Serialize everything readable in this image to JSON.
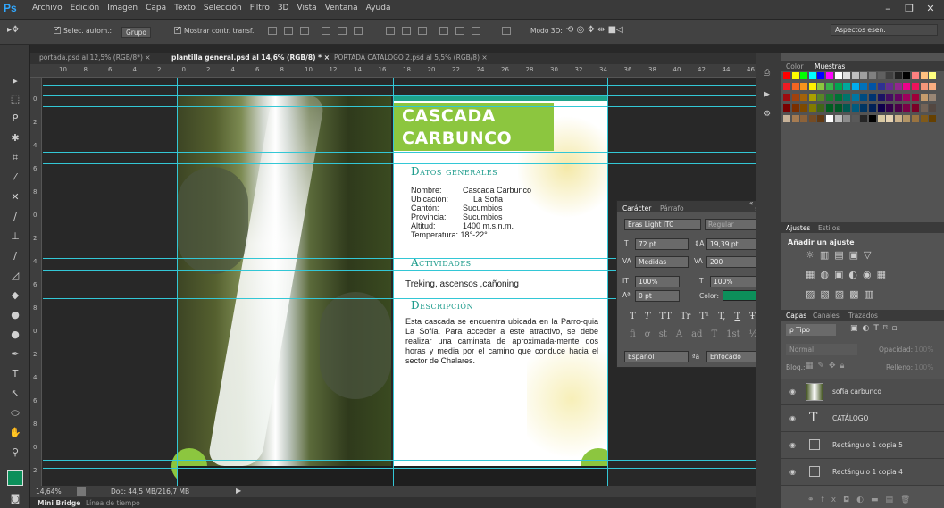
{
  "app": {
    "logo": "Ps"
  },
  "menu": [
    "Archivo",
    "Edición",
    "Imagen",
    "Capa",
    "Texto",
    "Selección",
    "Filtro",
    "3D",
    "Vista",
    "Ventana",
    "Ayuda"
  ],
  "window_controls": {
    "minimize": "–",
    "restore": "❐",
    "close": "✕"
  },
  "options": {
    "auto_select_label": "Selec. autom.:",
    "auto_select_value": "Grupo",
    "show_transform_label": "Mostrar contr. transf.",
    "mode3d_label": "Modo 3D:",
    "workspace": "Aspectos esen."
  },
  "tabs": [
    {
      "label": "portada.psd al 12,5% (RGB/8*)",
      "close": "×"
    },
    {
      "label": "plantilla general.psd al 14,6% (RGB/8) *",
      "close": "×"
    },
    {
      "label": "PORTADA CATALOGO 2.psd al 5,5% (RGB/8)",
      "close": "×"
    }
  ],
  "ruler_top": [
    "10",
    "8",
    "6",
    "4",
    "2",
    "0",
    "2",
    "4",
    "6",
    "8",
    "10",
    "12",
    "14",
    "16",
    "18",
    "20",
    "22",
    "24",
    "26",
    "28",
    "30",
    "32",
    "34",
    "36",
    "38",
    "40",
    "42",
    "44",
    "46"
  ],
  "ruler_left": [
    "0",
    "2",
    "4",
    "6",
    "8",
    "0",
    "2",
    "4",
    "6",
    "8",
    "0",
    "2",
    "4",
    "6",
    "8",
    "0",
    "2"
  ],
  "document": {
    "title_line1": "CASCADA",
    "title_line2": "CARBUNCO",
    "section1": "Datos generales",
    "fields": [
      {
        "label": "Nombre:",
        "value": "Cascada Carbunco"
      },
      {
        "label": "Ubicación:",
        "value": "La Sofia"
      },
      {
        "label": "Cantón:",
        "value": "Sucumbios"
      },
      {
        "label": "Provincia:",
        "value": "Sucumbios"
      },
      {
        "label": "Altitud:",
        "value": "1400 m.s.n.m."
      }
    ],
    "temperature": "Temperatura: 18°-22°",
    "section2": "Actividades",
    "activities": "Treking, ascensos ,cañoning",
    "section3": "Descripción",
    "description": "Esta cascada se encuentra ubicada en la Parro-quia La Sofía. Para acceder a este atractivo, se debe realizar una caminata de aproximada-mente dos horas y media por el camino que conduce hacia el sector de Chalares."
  },
  "status": {
    "zoom": "14,64%",
    "doc": "Doc: 44,5 MB/216,7 MB"
  },
  "bottom_tabs": [
    "Mini Bridge",
    "Línea de tiempo"
  ],
  "char_panel": {
    "tab_char": "Carácter",
    "tab_para": "Párrafo",
    "font": "Eras Light ITC",
    "style": "Regular",
    "size": "72 pt",
    "leading": "19,39 pt",
    "kerning": "Medidas",
    "tracking": "200",
    "vscale": "100%",
    "hscale": "100%",
    "baseline": "0 pt",
    "color_label": "Color:",
    "color": "#0c8f5a",
    "glyphs": [
      "T",
      "T",
      "TT",
      "Tr",
      "T¹",
      "T,",
      "T",
      "Ŧ"
    ],
    "opentype": [
      "fi",
      "ơ",
      "st",
      "A",
      "ad",
      "T",
      "1st",
      "½"
    ],
    "language": "Español",
    "aa": "ªa",
    "antialias": "Enfocado"
  },
  "right_panel": {
    "color_tabs": [
      "Color",
      "Muestras"
    ],
    "adjust_tabs": [
      "Ajustes",
      "Estilos"
    ],
    "add_adjust": "Añadir un ajuste",
    "layers_tabs": [
      "Capas",
      "Canales",
      "Trazados"
    ],
    "filter": "ρ Tipo",
    "blend": "Normal",
    "opacity_label": "Opacidad:",
    "opacity": "100%",
    "lock_label": "Bloq.:",
    "fill_label": "Relleno:",
    "fill": "100%",
    "layers": [
      {
        "name": "sofia carbunco",
        "type": "image"
      },
      {
        "name": "CATÁLOGO",
        "type": "text"
      },
      {
        "name": "Rectángulo 1 copia 5",
        "type": "shape"
      },
      {
        "name": "Rectángulo 1 copia 4",
        "type": "shape"
      }
    ]
  },
  "colors": {
    "guide": "#33c7d6",
    "title_green": "#8cc63f",
    "teal": "#1a9a8a"
  }
}
